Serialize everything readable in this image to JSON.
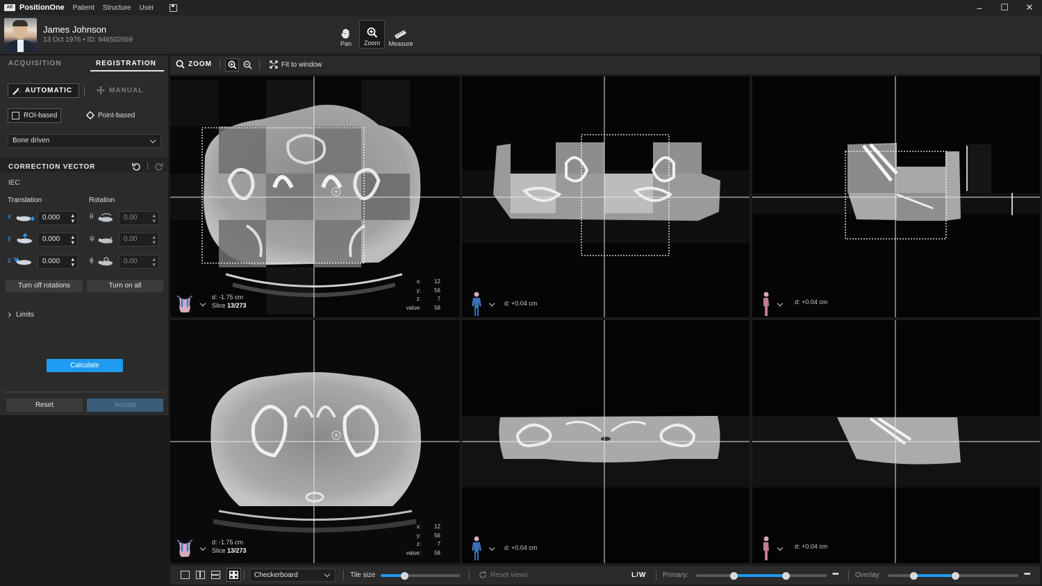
{
  "app": {
    "name": "PositionOne",
    "logo_text": "AR",
    "menu": [
      "Patient",
      "Structure",
      "User"
    ]
  },
  "window_controls": {
    "minimize": "–",
    "maximize": "☐",
    "close": "✕"
  },
  "patient": {
    "name": "James Johnson",
    "meta": "13 Oct 1976  •  ID: 946502669"
  },
  "tools": {
    "pan": "Pan",
    "zoom": "Zoom",
    "measure": "Measure",
    "active": "zoom"
  },
  "left_panel": {
    "tabs": {
      "acquisition": "ACQUISITION",
      "registration": "REGISTRATION"
    },
    "mode": {
      "automatic": "AUTOMATIC",
      "manual": "MANUAL"
    },
    "method": {
      "roi": "ROI-based",
      "point": "Point-based"
    },
    "preset": "Bone driven",
    "correction_vector": {
      "title": "CORRECTION VECTOR",
      "frame": "IEC",
      "translation_label": "Translation",
      "rotation_label": "Rotation",
      "translation": [
        {
          "axis": "x",
          "value": "0.000"
        },
        {
          "axis": "y",
          "value": "0.000"
        },
        {
          "axis": "z",
          "value": "0.000"
        }
      ],
      "rotation": [
        {
          "axis": "θ",
          "value": "0.00"
        },
        {
          "axis": "ψ",
          "value": "0.00"
        },
        {
          "axis": "ϕ",
          "value": "0.00"
        }
      ]
    },
    "turn_off_rotations": "Turn off rotations",
    "turn_on_all": "Turn on all",
    "limits": "Limits",
    "calculate": "Calculate",
    "reset": "Reset",
    "accept": "Accept"
  },
  "zoom_toolbar": {
    "title": "ZOOM",
    "fit": "Fit to window"
  },
  "viewports": {
    "axial_top": {
      "distance": "d: -1.75 cm",
      "slice_label": "Slice",
      "slice": "13/273",
      "coords": {
        "x": "12",
        "y": "56",
        "z": "7",
        "value": "58"
      }
    },
    "coronal_top": {
      "distance": "d: +0.04 cm"
    },
    "sagittal_top": {
      "distance": "d: +0.04 cm"
    },
    "axial_bottom": {
      "distance": "d: -1.75 cm",
      "slice_label": "Slice",
      "slice": "13/273",
      "coords": {
        "x": "12",
        "y": "56",
        "z": "7",
        "value": "58"
      }
    },
    "coronal_bottom": {
      "distance": "d: +0.04 cm"
    },
    "sagittal_bottom": {
      "distance": "d: +0.04 cm"
    }
  },
  "coord_labels": {
    "x": "x:",
    "y": "y:",
    "z": "z:",
    "value": "value:"
  },
  "status_bar": {
    "overlay_mode": "Checkerboard",
    "tile_size_label": "Tile size",
    "tile_size_level": 0.3,
    "reset_views": "Reset views",
    "lw": "L/W",
    "primary_label": "Primary:",
    "primary_range": [
      0.29,
      0.69
    ],
    "overlay_label": "Overlay:",
    "overlay_range": [
      0.2,
      0.52
    ],
    "more": "•••"
  },
  "colors": {
    "accent": "#1e9bf0",
    "axis": "#3ba4ff"
  }
}
